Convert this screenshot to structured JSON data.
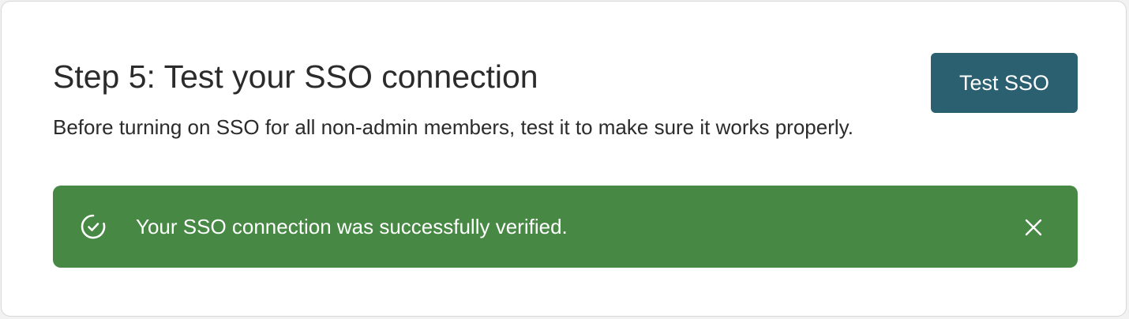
{
  "step": {
    "title": "Step 5: Test your SSO connection",
    "description": "Before turning on SSO for all non-admin members, test it to make sure it works properly.",
    "button_label": "Test SSO"
  },
  "alert": {
    "message": "Your SSO connection was successfully verified.",
    "status": "success",
    "icon": "check-circle-icon",
    "close_icon": "close-icon",
    "color": "#468844"
  },
  "colors": {
    "button": "#2a6070",
    "card_border": "#d8d8d8",
    "text": "#2b2b2b"
  }
}
